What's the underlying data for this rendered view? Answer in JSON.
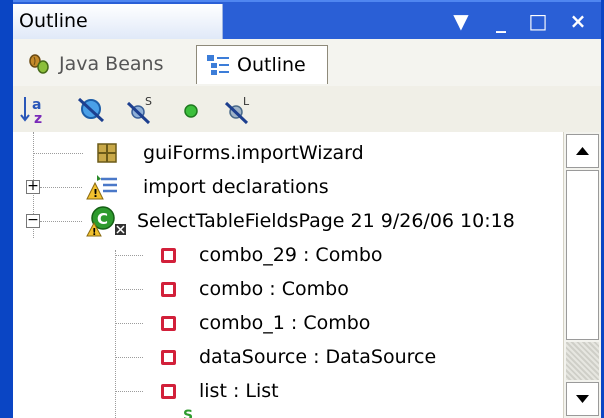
{
  "window": {
    "title": "Outline",
    "controls": {
      "menu": "▼",
      "minimize": "_",
      "maximize": "□",
      "close": "×"
    }
  },
  "tabs": [
    {
      "label": "Java Beans",
      "icon": "java-beans-icon",
      "active": false
    },
    {
      "label": "Outline",
      "icon": "outline-icon",
      "active": true
    }
  ],
  "toolbar": {
    "buttons": [
      {
        "name": "sort-alphabetically",
        "icon": "sort-az-icon"
      },
      {
        "name": "hide-fields",
        "icon": "hide-fields-icon"
      },
      {
        "name": "hide-static",
        "icon": "hide-static-icon"
      },
      {
        "name": "hide-non-public",
        "icon": "hide-non-public-icon"
      },
      {
        "name": "hide-local-types",
        "icon": "hide-local-types-icon"
      }
    ]
  },
  "tree": {
    "items": [
      {
        "label": "guiForms.importWizard",
        "icon": "package-icon",
        "level": 0,
        "expander": ""
      },
      {
        "label": "import declarations",
        "icon": "imports-icon",
        "level": 0,
        "expander": "+"
      },
      {
        "label": "SelectTableFieldsPage 21  9/26/06 10:18",
        "icon": "class-icon",
        "level": 0,
        "expander": "−"
      },
      {
        "label": "combo_29 : Combo",
        "icon": "private-field-icon",
        "level": 1
      },
      {
        "label": "combo : Combo",
        "icon": "private-field-icon",
        "level": 1
      },
      {
        "label": "combo_1 : Combo",
        "icon": "private-field-icon",
        "level": 1
      },
      {
        "label": "dataSource : DataSource",
        "icon": "private-field-icon",
        "level": 1
      },
      {
        "label": "list : List",
        "icon": "private-field-icon",
        "level": 1
      }
    ]
  },
  "colors": {
    "selection_frame": "#0a45c4",
    "field_icon": "#d2203a",
    "class_icon": "#2e9b2e"
  }
}
